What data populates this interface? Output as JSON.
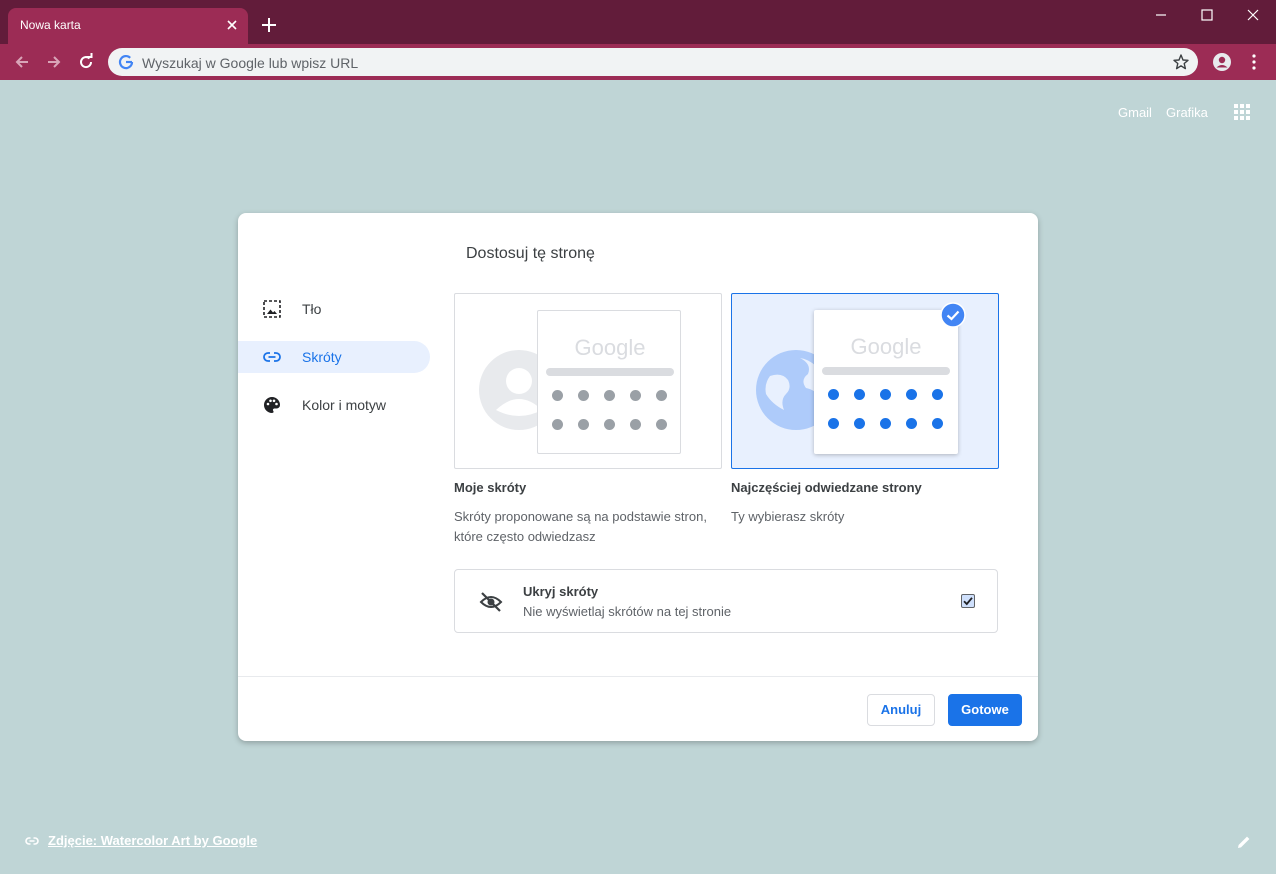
{
  "tab": {
    "title": "Nowa karta"
  },
  "omnibox": {
    "placeholder": "Wyszukaj w Google lub wpisz URL"
  },
  "header_links": {
    "gmail": "Gmail",
    "images": "Grafika"
  },
  "dialog": {
    "title": "Dostosuj tę stronę",
    "sidebar": [
      {
        "label": "Tło",
        "icon": "image-icon"
      },
      {
        "label": "Skróty",
        "icon": "link-icon",
        "active": true
      },
      {
        "label": "Kolor i motyw",
        "icon": "palette-icon"
      }
    ],
    "options": [
      {
        "title": "Moje skróty",
        "description": "Skróty proponowane są na podstawie stron, które często odwiedzasz",
        "preview_logo": "Google",
        "selected": false
      },
      {
        "title": "Najczęściej odwiedzane strony",
        "description": "Ty wybierasz skróty",
        "preview_logo": "Google",
        "selected": true
      }
    ],
    "hide_shortcuts": {
      "title": "Ukryj skróty",
      "subtitle": "Nie wyświetlaj skrótów na tej stronie",
      "checked": true
    },
    "buttons": {
      "cancel": "Anuluj",
      "done": "Gotowe"
    }
  },
  "footer": {
    "attribution": "Zdjęcie: Watercolor Art by Google"
  },
  "colors": {
    "accent": "#1a73e8",
    "titlebar": "#621c3a",
    "toolbar": "#9c2c55",
    "background": "#bfd5d6"
  }
}
